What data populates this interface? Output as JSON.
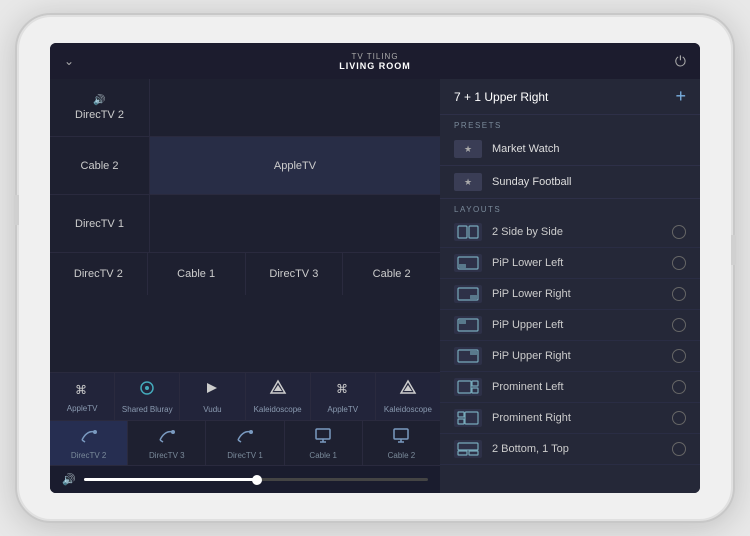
{
  "topBar": {
    "subtitle": "TV TILING",
    "title": "LIVING ROOM",
    "chevron": "⌄",
    "power": "⏻"
  },
  "grid": {
    "rows": [
      [
        {
          "label": "DirecTV 2",
          "icon": "🔊",
          "span": 1,
          "hasIcon": true
        },
        {
          "label": "",
          "span": 2
        }
      ],
      [
        {
          "label": "Cable 2",
          "span": 1
        },
        {
          "label": "AppleTV",
          "span": 2,
          "wide": true
        }
      ],
      [
        {
          "label": "DirecTV 1",
          "span": 1
        },
        {
          "label": "",
          "span": 2
        }
      ],
      [
        {
          "label": "DirecTV 2",
          "span": 1
        },
        {
          "label": "Cable 1",
          "span": 1
        },
        {
          "label": "DirecTV 3",
          "span": 1
        },
        {
          "label": "Cable 2",
          "span": 1
        }
      ]
    ],
    "sourceIcons": [
      {
        "label": "AppleTV",
        "icon": "tv"
      },
      {
        "label": "Shared Bluray",
        "icon": "bluray"
      },
      {
        "label": "Vudu",
        "icon": "play"
      },
      {
        "label": "Kaleidoscope",
        "icon": "kaleid"
      },
      {
        "label": "AppleTV",
        "icon": "tv2"
      },
      {
        "label": "Kaleidoscope",
        "icon": "kaleid2"
      }
    ],
    "satIcons": [
      {
        "label": "DirecTV 2",
        "active": true
      },
      {
        "label": "DirecTV 3"
      },
      {
        "label": "DirecTV 1"
      },
      {
        "label": "Cable 1"
      },
      {
        "label": "Cable 2"
      }
    ]
  },
  "volume": {
    "fill": 50
  },
  "rightPanel": {
    "title": "7 + 1 Upper Right",
    "addIcon": "+",
    "presetsLabel": "PRESETS",
    "presets": [
      {
        "label": "Market Watch"
      },
      {
        "label": "Sunday Football"
      }
    ],
    "layoutsLabel": "LAYOUTS",
    "layouts": [
      {
        "label": "2 Side by Side",
        "selected": false
      },
      {
        "label": "PiP Lower Left",
        "selected": false
      },
      {
        "label": "PiP Lower Right",
        "selected": false
      },
      {
        "label": "PiP Upper Left",
        "selected": false
      },
      {
        "label": "PiP Upper Right",
        "selected": false
      },
      {
        "label": "Prominent Left",
        "selected": false
      },
      {
        "label": "Prominent Right",
        "selected": false
      },
      {
        "label": "2 Bottom, 1 Top",
        "selected": false
      }
    ]
  }
}
